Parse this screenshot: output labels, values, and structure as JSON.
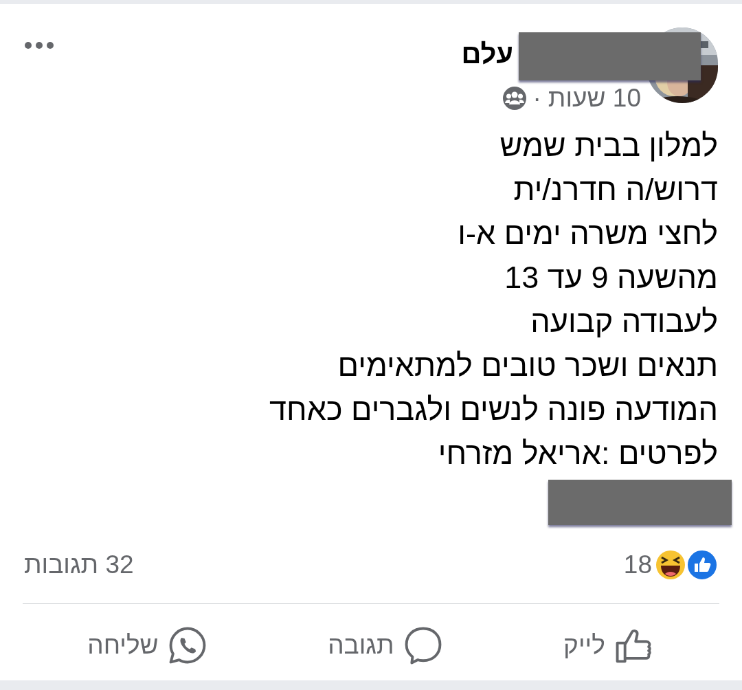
{
  "post": {
    "author": {
      "name": "עלם"
    },
    "time": "10 שעות",
    "separator": "·",
    "audience": {
      "kind": "group"
    },
    "body_lines": [
      "למלון בבית שמש",
      "דרוש/ה חדרנ/ית",
      "לחצי משרה ימים א-ו",
      "מהשעה 9 עד 13",
      "לעבודה קבועה",
      "תנאים ושכר טובים למתאימים",
      "המודעה פונה לנשים ולגברים כאחד",
      "לפרטים :אריאל מזרחי"
    ],
    "reactions": {
      "icons": [
        {
          "kind": "like"
        },
        {
          "kind": "haha"
        }
      ],
      "count": "18"
    },
    "comments": "32 תגובות",
    "actions": [
      {
        "kind": "like",
        "label": "לייק"
      },
      {
        "kind": "comment",
        "label": "תגובה"
      },
      {
        "kind": "share",
        "label": "שליחה"
      }
    ]
  }
}
